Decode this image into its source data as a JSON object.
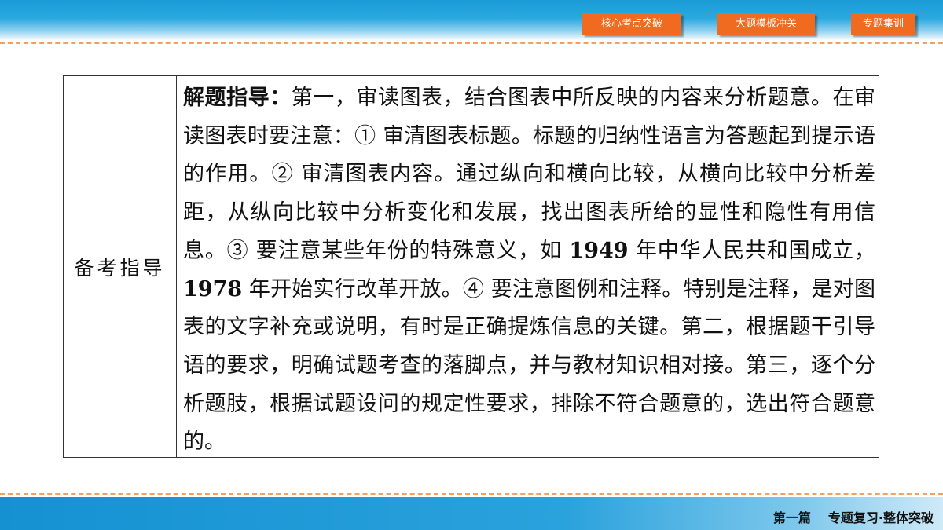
{
  "nav": {
    "buttons": [
      "核心考点突破",
      "大题模板冲关",
      "专题集训"
    ]
  },
  "table": {
    "label": "备考指导",
    "heading": "解题指导：",
    "body_1": "第一，审读图表，结合图表中所反映的内容来分析题意。在审读图表时要注意：① 审清图表标题。标题的归纳性语言为答题起到提示语的作用。② 审清图表内容。通过纵向和横向比较，从横向比较中分析差距，从纵向比较中分析变化和发展，找出图表所给的显性和隐性有用信息。③ 要注意某些年份的特殊意义，如 ",
    "year_1": "1949",
    "body_2": " 年中华人民共和国成立，",
    "year_2": "1978",
    "body_3": " 年开始实行改革开放。④ 要注意图例和注释。特别是注释，是对图表的文字补充或说明，有时是正确提炼信息的关键。第二，根据题干引导语的要求，明确试题考查的落脚点，并与教材知识相对接。第三，逐个分析题肢，根据试题设问的规定性要求，排除不符合题意的，选出符合题意的。"
  },
  "footer": {
    "part": "第一篇",
    "title": "专题复习·整体突破"
  },
  "colors": {
    "header_blue": "#1a9bd7",
    "button_orange": "#f06a1f",
    "dash_orange": "#f0a060"
  }
}
